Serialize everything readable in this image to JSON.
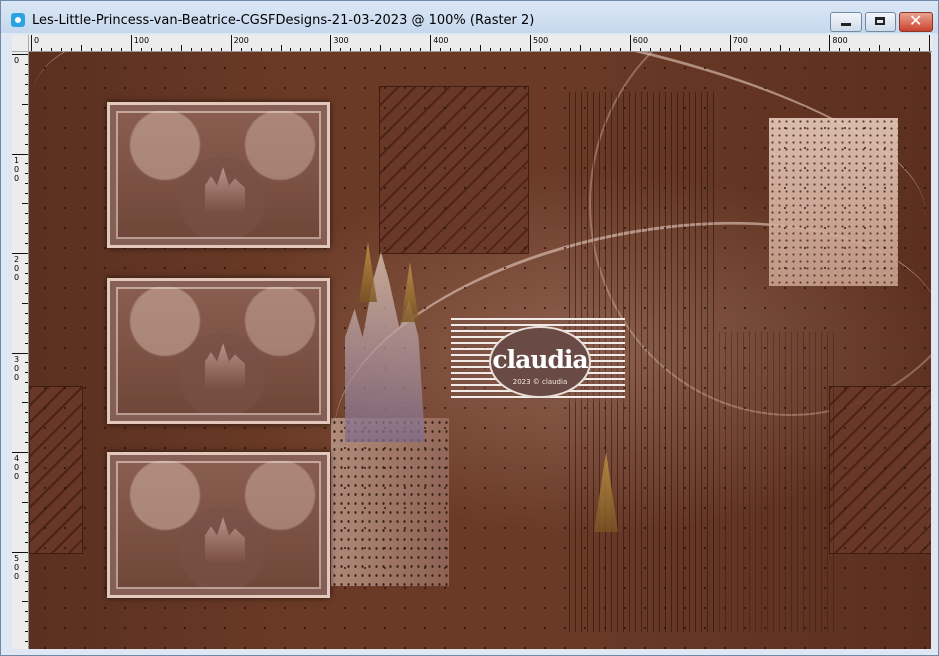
{
  "window": {
    "title": "Les-Little-Princess-van-Beatrice-CGSFDesigns-21-03-2023 @ 100% (Raster 2)",
    "icon": "paintshop-pro-image-icon",
    "controls": {
      "minimize": "minimize-icon",
      "maximize": "maximize-icon",
      "close": "close-icon"
    }
  },
  "rulers": {
    "horizontal_labels": [
      "0",
      "100",
      "200",
      "300",
      "400",
      "500",
      "600",
      "700",
      "800"
    ],
    "vertical_labels": [
      "0",
      "100",
      "200",
      "300",
      "400",
      "500"
    ]
  },
  "canvas": {
    "watermark_text": "claudia",
    "watermark_subtext": "2023 © claudia",
    "colors": {
      "background": "#6a3a27",
      "frame_border": "#e2c8bd",
      "light_panel": "#e8cbbd"
    }
  }
}
